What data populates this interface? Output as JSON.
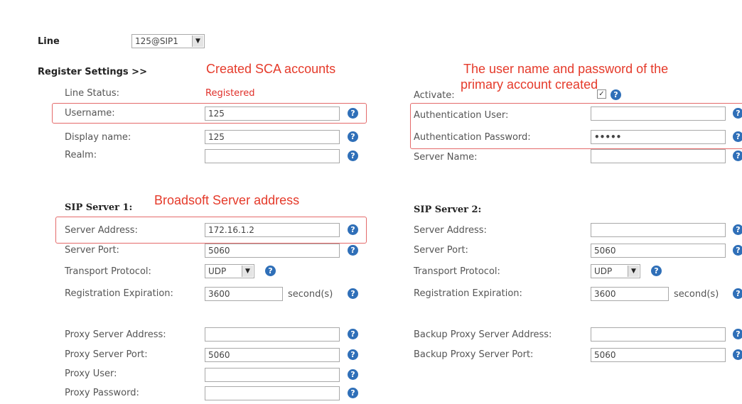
{
  "line": {
    "label": "Line",
    "value": "125@SIP1"
  },
  "register_settings": {
    "title": "Register Settings >>"
  },
  "annotations": {
    "sca": "Created SCA accounts",
    "primary_line1": "The user name and password of the",
    "primary_line2": "primary account created",
    "broadsoft": "Broadsoft Server address"
  },
  "left": {
    "line_status_label": "Line Status:",
    "line_status_value": "Registered",
    "username_label": "Username:",
    "username_value": "125",
    "display_name_label": "Display name:",
    "display_name_value": "125",
    "realm_label": "Realm:",
    "realm_value": ""
  },
  "right": {
    "activate_label": "Activate:",
    "auth_user_label": "Authentication User:",
    "auth_user_value": "",
    "auth_pass_label": "Authentication Password:",
    "auth_pass_value": "•••••",
    "server_name_label": "Server Name:",
    "server_name_value": ""
  },
  "sip1": {
    "title": "SIP Server 1:",
    "server_address_label": "Server Address:",
    "server_address_value": "172.16.1.2",
    "server_port_label": "Server Port:",
    "server_port_value": "5060",
    "transport_label": "Transport Protocol:",
    "transport_value": "UDP",
    "expiration_label": "Registration Expiration:",
    "expiration_value": "3600",
    "seconds_label": "second(s)",
    "proxy_address_label": "Proxy Server Address:",
    "proxy_address_value": "",
    "proxy_port_label": "Proxy Server Port:",
    "proxy_port_value": "5060",
    "proxy_user_label": "Proxy User:",
    "proxy_user_value": "",
    "proxy_password_label": "Proxy Password:",
    "proxy_password_value": ""
  },
  "sip2": {
    "title": "SIP Server 2:",
    "server_address_label": "Server Address:",
    "server_address_value": "",
    "server_port_label": "Server Port:",
    "server_port_value": "5060",
    "transport_label": "Transport Protocol:",
    "transport_value": "UDP",
    "expiration_label": "Registration Expiration:",
    "expiration_value": "3600",
    "seconds_label": "second(s)",
    "backup_proxy_address_label": "Backup Proxy Server Address:",
    "backup_proxy_address_value": "",
    "backup_proxy_port_label": "Backup Proxy Server Port:",
    "backup_proxy_port_value": "5060"
  },
  "help_glyph": "?",
  "dropdown_glyph": "▼",
  "check_glyph": "✓",
  "colors": {
    "annotation": "#e53a2a",
    "help_icon": "#2f6fb8",
    "status_registered": "#e0302a"
  }
}
